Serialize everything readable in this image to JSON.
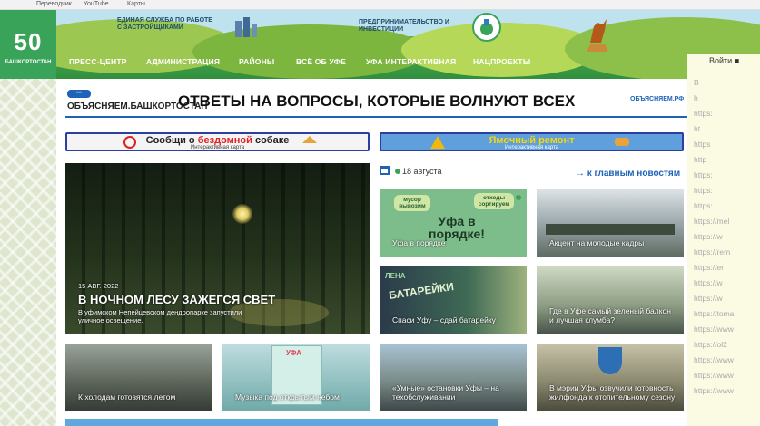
{
  "bookmarks": [
    "Переводчик",
    "YouTube",
    "Карты"
  ],
  "logo": {
    "number": "50",
    "caption": "БАШКОРТОСТАН"
  },
  "header": {
    "service1": "ЕДИНАЯ СЛУЖБА ПО РАБОТЕ С ЗАСТРОЙЩИКАМИ",
    "service2": "ПРЕДПРИНИМАТЕЛЬСТВО И ИНВЕСТИЦИИ",
    "nav": [
      "ПРЕСС-ЦЕНТР",
      "АДМИНИСТРАЦИЯ",
      "РАЙОНЫ",
      "ВСЁ ОБ УФЕ",
      "УФА ИНТЕРАКТИВНАЯ",
      "НАЦПРОЕКТЫ"
    ],
    "login": "Войти"
  },
  "obyasnyaem": {
    "badge": "•••",
    "brand": "ОБЪЯСНЯЕМ.БАШКОРТОСТАН",
    "headline": "ОТВЕТЫ НА ВОПРОСЫ, КОТОРЫЕ ВОЛНУЮТ ВСЕХ",
    "right_logo": "ОБЪЯСНЯЕМ.РФ"
  },
  "banners": [
    {
      "title_pre": "Сообщи о ",
      "title_hl": "бездомной",
      "title_post": " собаке",
      "sub": "Интерактивная карта"
    },
    {
      "title_pre": "",
      "title_hl": "Ямочный ремонт",
      "title_post": "",
      "sub": "Интерактивная карта"
    }
  ],
  "date": "18 августа",
  "main_news_link": "→ к главным новостям",
  "featured": {
    "date": "15 АВГ. 2022",
    "title": "В НОЧНОМ ЛЕСУ ЗАЖЕГСЯ СВЕТ",
    "lead": "В уфимском Непейцевском дендропарке запустили уличное освещение."
  },
  "tiles": [
    {
      "caption": "Уфа в порядке",
      "sign1": "мусор вывозим",
      "sign2": "отходы сортируем",
      "sign3": "Уфа в порядке!"
    },
    {
      "caption": "Акцент на молодые кадры"
    },
    {
      "caption": "Спаси Уфу – сдай батарейку",
      "sign1": "ЛЕНА",
      "sign2": "БАТАРЕЙКИ"
    },
    {
      "caption": "Где в Уфе самый зеленый балкон и лучшая клумба?"
    },
    {
      "caption": "К холодам готовятся летом"
    },
    {
      "caption": "Музыка под открытым небом",
      "sign1": "УФА"
    },
    {
      "caption": "«Умные» остановки Уфы – на техобслуживании"
    },
    {
      "caption": "В мэрии Уфы озвучили готовность жилфонда к отопительному сезону"
    }
  ],
  "sidebar_links": [
    "B",
    "h",
    "https:",
    "ht",
    "https",
    "http",
    "https:",
    "https:",
    "https:",
    "https://mel",
    "https://w",
    "https://rem",
    "https://er",
    "https://w",
    "https://w",
    "https://toma",
    "https://www",
    "https://ol2",
    "https://www",
    "https://www",
    "https://www"
  ]
}
